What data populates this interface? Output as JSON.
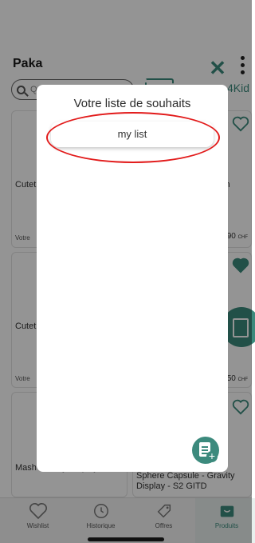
{
  "header": {
    "title": "Paka",
    "kids_label": "4Kid"
  },
  "search": {
    "placeholder": "Q"
  },
  "products": [
    {
      "name": "Cutet W1 as",
      "tag": "Votre",
      "right_name": "sh",
      "price": "90",
      "currency": "CHF"
    },
    {
      "name": "Cutet Plush",
      "tag": "Votre",
      "price": "50",
      "currency": "CHF"
    },
    {
      "name": "Mash Gravity Display - S2",
      "right_name": "Sphere Capsule - Gravity Display - S2 GITD"
    }
  ],
  "modal": {
    "title": "Votre liste de souhaits",
    "lists": [
      "my list"
    ]
  },
  "bottom_nav": {
    "items": [
      {
        "label": "Wishlist",
        "icon": "heart-icon"
      },
      {
        "label": "Historique",
        "icon": "history-icon"
      },
      {
        "label": "Offres",
        "icon": "tag-icon"
      },
      {
        "label": "Produits",
        "icon": "box-icon"
      }
    ]
  },
  "colors": {
    "accent": "#3c8a7d",
    "annotation": "#e21b1b"
  }
}
